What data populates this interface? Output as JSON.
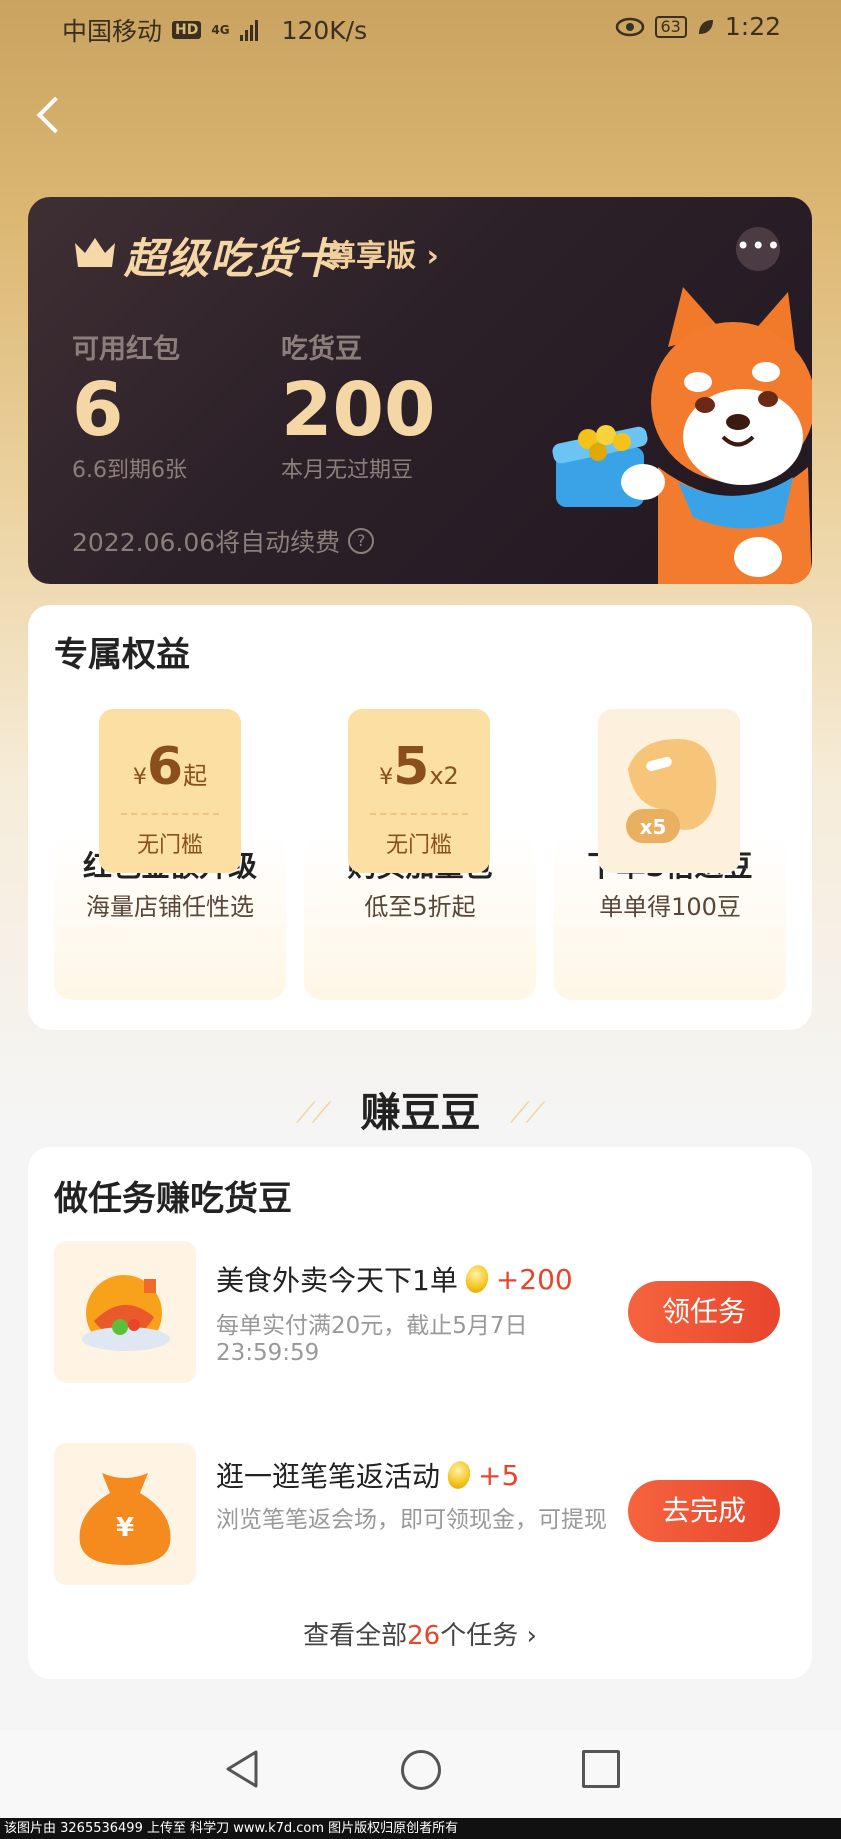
{
  "status_bar": {
    "carrier": "中国移动",
    "hd": "HD",
    "network": "4G",
    "speed": "120K/s",
    "battery": "63",
    "time": "1:22"
  },
  "vip_card": {
    "title": "超级吃货卡",
    "edition": "尊享版 ›",
    "more": "•••",
    "red_packet_label": "可用红包",
    "red_packet_count": "6",
    "red_packet_expiry": "6.6到期6张",
    "beans_label": "吃货豆",
    "beans_count": "200",
    "beans_note": "本月无过期豆",
    "renew_text": "2022.06.06将自动续费",
    "help": "?"
  },
  "benefits": {
    "title": "专属权益",
    "items": [
      {
        "currency": "¥",
        "amount": "6",
        "suffix": "起",
        "threshold": "无门槛",
        "name": "红包金额升级",
        "desc": "海量店铺任性选"
      },
      {
        "currency": "¥",
        "amount": "5",
        "suffix": "x2",
        "threshold": "无门槛",
        "name": "购买加量包",
        "desc": "低至5折起"
      },
      {
        "badge": "x5",
        "name": "下单5倍返豆",
        "desc": "单单得100豆"
      }
    ]
  },
  "earn": {
    "title": "赚豆豆",
    "card_title": "做任务赚吃货豆",
    "tasks": [
      {
        "title": "美食外卖今天下1单",
        "bonus": "+200",
        "desc": "每单实付满20元，截止5月7日 23:59:59",
        "button": "领任务",
        "icon": "food-icon"
      },
      {
        "title": "逛一逛笔笔返活动",
        "bonus": "+5",
        "desc": "浏览笔笔返会场，即可领现金，可提现",
        "button": "去完成",
        "icon": "money-bag-icon",
        "bag_symbol": "¥"
      }
    ],
    "view_all_prefix": "查看全部",
    "view_all_count": "26",
    "view_all_suffix": "个任务 ›"
  },
  "watermark": "该图片由 3265536499 上传至 科学刀 www.k7d.com 图片版权归原创者所有",
  "colors": {
    "accent": "#e8452c",
    "gold": "#f5d7a6",
    "card_dark": "#2c2028"
  }
}
